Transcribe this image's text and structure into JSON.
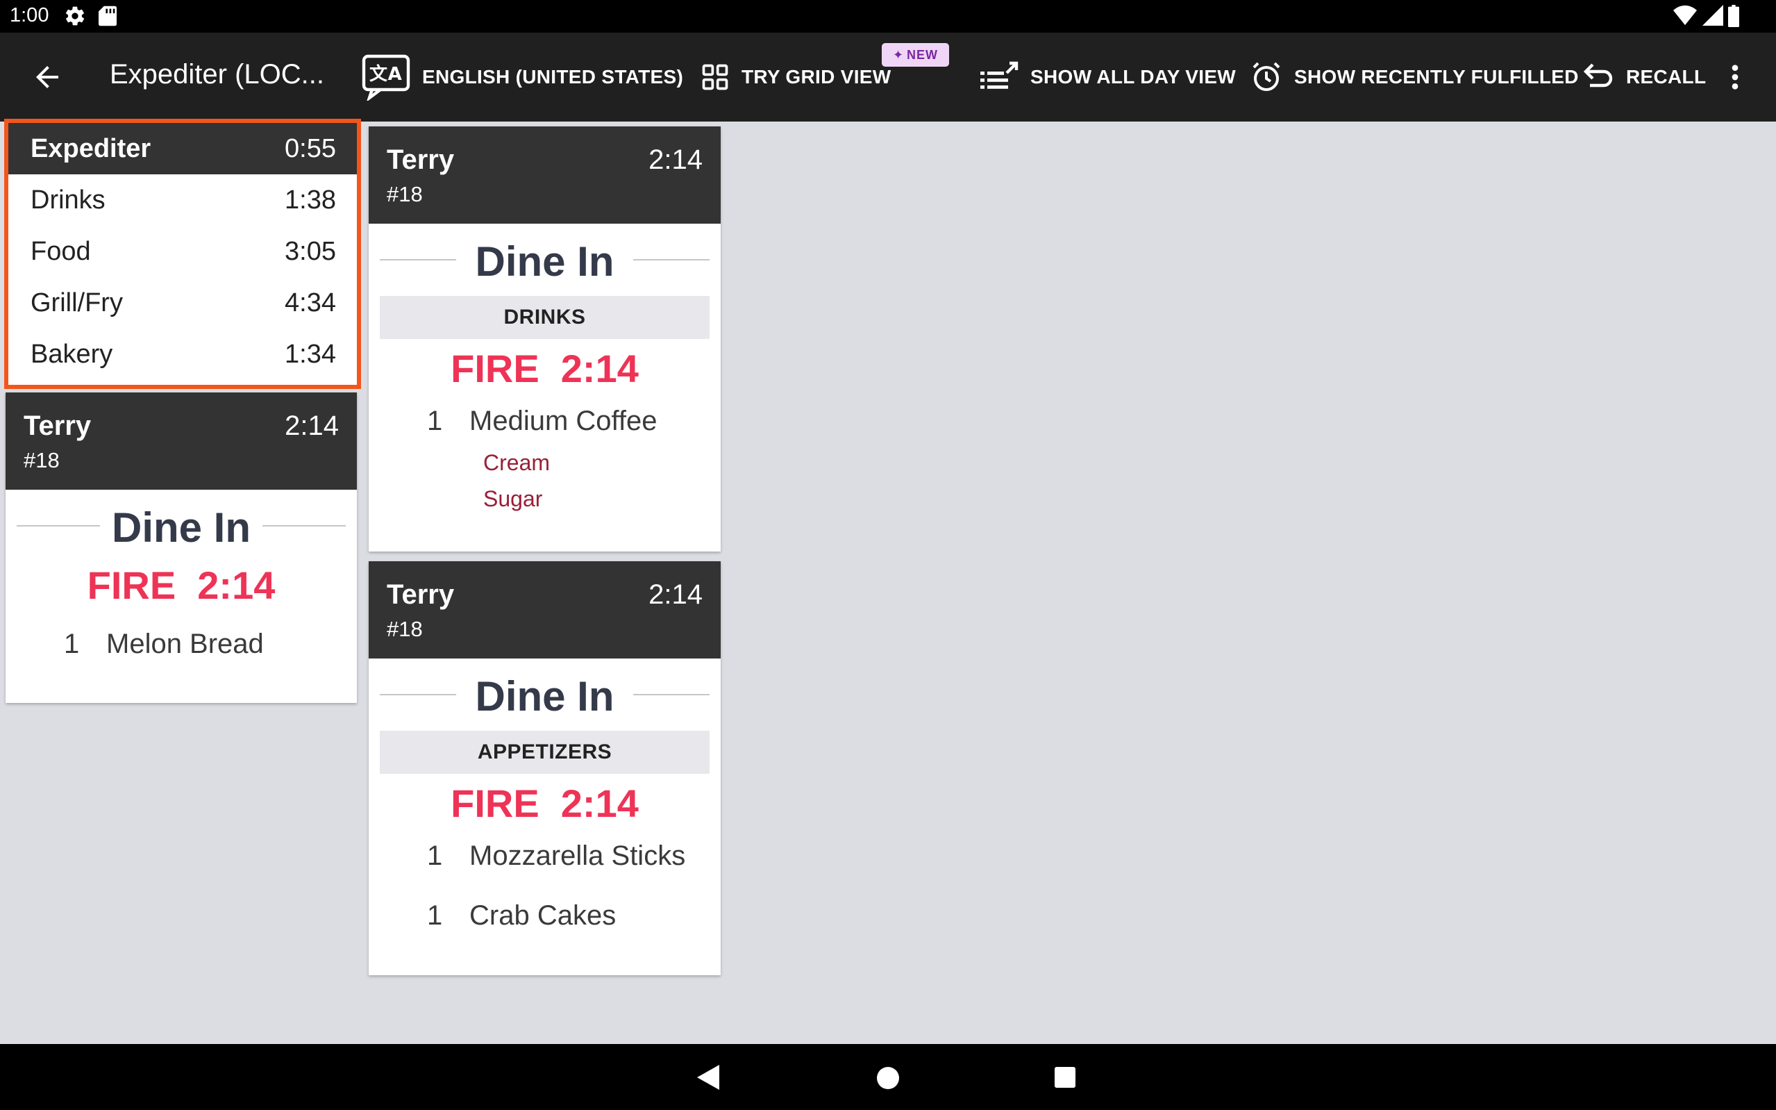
{
  "status_bar": {
    "time": "1:00"
  },
  "app_bar": {
    "title": "Expediter (LOC...",
    "actions": {
      "language": "ENGLISH (UNITED STATES)",
      "grid_view": "TRY GRID VIEW",
      "new_badge": "NEW",
      "all_day": "SHOW ALL DAY VIEW",
      "recently_fulfilled": "SHOW RECENTLY FULFILLED",
      "recall": "RECALL"
    }
  },
  "summary": {
    "header": {
      "label": "Expediter",
      "time": "0:55"
    },
    "rows": [
      {
        "label": "Drinks",
        "time": "1:38"
      },
      {
        "label": "Food",
        "time": "3:05"
      },
      {
        "label": "Grill/Fry",
        "time": "4:34"
      },
      {
        "label": "Bakery",
        "time": "1:34"
      }
    ]
  },
  "tickets": [
    {
      "name": "Terry",
      "time": "2:14",
      "number": "#18",
      "dining": "Dine In",
      "section": "",
      "fire": "FIRE  2:14",
      "items": [
        {
          "qty": "1",
          "name": "Melon Bread",
          "modifiers": []
        }
      ]
    },
    {
      "name": "Terry",
      "time": "2:14",
      "number": "#18",
      "dining": "Dine In",
      "section": "DRINKS",
      "fire": "FIRE  2:14",
      "items": [
        {
          "qty": "1",
          "name": "Medium Coffee",
          "modifiers": [
            "Cream",
            "Sugar"
          ]
        }
      ]
    },
    {
      "name": "Terry",
      "time": "2:14",
      "number": "#18",
      "dining": "Dine In",
      "section": "APPETIZERS",
      "fire": "FIRE  2:14",
      "items": [
        {
          "qty": "1",
          "name": "Mozzarella Sticks",
          "modifiers": []
        },
        {
          "qty": "1",
          "name": "Crab Cakes",
          "modifiers": []
        }
      ]
    }
  ],
  "colors": {
    "fire": "#ee3356",
    "highlight": "#f2561b",
    "modifier": "#9a1f38",
    "header": "#333333"
  }
}
